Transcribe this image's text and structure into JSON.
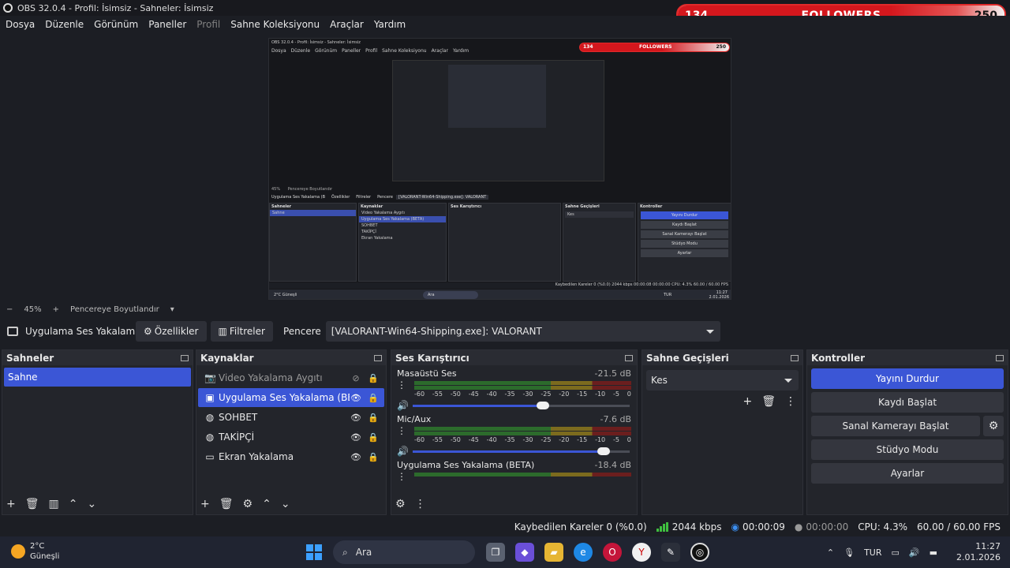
{
  "window": {
    "title": "OBS 32.0.4 - Profil: İsimsiz - Sahneler: İsimsiz"
  },
  "menu": [
    "Dosya",
    "Düzenle",
    "Görünüm",
    "Paneller",
    "Profil",
    "Sahne Koleksiyonu",
    "Araçlar",
    "Yardım"
  ],
  "followers_widget": {
    "current": "134",
    "label": "FOLLOWERS",
    "goal": "250",
    "progress": 0.536,
    "color": "#d4171d"
  },
  "preview": {
    "mini_title": "OBS 32.0.4 - Profil: İsimsiz - Sahneler: İsimsiz",
    "mini_menu": [
      "Dosya",
      "Düzenle",
      "Görünüm",
      "Paneller",
      "Profil",
      "Sahne Koleksiyonu",
      "Araçlar",
      "Yardım"
    ],
    "mini_followers": {
      "current": "134",
      "label": "FOLLOWERS",
      "goal": "250"
    },
    "mini_zoom": "45%",
    "mini_fit": "Pencereye Boyutlandır",
    "mini_source": "Uygulama Ses Yakalama (B",
    "mini_props": "Özellikler",
    "mini_filters": "Filtreler",
    "mini_window_label": "Pencere",
    "mini_window_value": "[VALORANT-Win64-Shipping.exe]: VALORANT",
    "mini_docks": {
      "scenes": "Sahneler",
      "scene": "Sahne",
      "sources": "Kaynaklar",
      "source_items": [
        "Video Yakalama Aygıtı",
        "Uygulama Ses Yakalama (BETA)",
        "SOHBET",
        "TAKİPÇİ",
        "Ekran Yakalama"
      ],
      "mixer": "Ses Karıştırıcı",
      "transitions": "Sahne Geçişleri",
      "transition": "Kes",
      "controls": "Kontroller",
      "control_buttons": [
        "Yayını Durdur",
        "Kaydı Başlat",
        "Sanal Kamerayı Başlat",
        "Stüdyo Modu",
        "Ayarlar"
      ]
    },
    "mini_status": "Kaybedilen Kareler 0 (%0.0)   2044 kbps   00:00:08   00:00:00   CPU: 4.3%   60.00 / 60.00 FPS",
    "mini_taskbar": {
      "weather": "2°C Güneşli",
      "search": "Ara",
      "lang": "TUR",
      "time": "11:27",
      "date": "2.01.2026"
    }
  },
  "zoom": {
    "minus": "−",
    "value": "45%",
    "plus": "+",
    "fit": "Pencereye Boyutlandır"
  },
  "source_bar": {
    "name": "Uygulama Ses Yakalama (B",
    "properties": "Özellikler",
    "filters": "Filtreler",
    "window_label": "Pencere",
    "window_value": "[VALORANT-Win64-Shipping.exe]: VALORANT"
  },
  "scenes": {
    "title": "Sahneler",
    "items": [
      "Sahne"
    ]
  },
  "sources": {
    "title": "Kaynaklar",
    "items": [
      {
        "name": "Video Yakalama Aygıtı",
        "icon": "camera-icon"
      },
      {
        "name": "Uygulama Ses Yakalama (BETA)",
        "icon": "app-audio-icon"
      },
      {
        "name": "SOHBET",
        "icon": "globe-icon"
      },
      {
        "name": "TAKİPÇİ",
        "icon": "globe-icon"
      },
      {
        "name": "Ekran Yakalama",
        "icon": "monitor-icon"
      }
    ]
  },
  "mixer": {
    "title": "Ses Karıştırıcı",
    "ticks": [
      "-60",
      "-55",
      "-50",
      "-45",
      "-40",
      "-35",
      "-30",
      "-25",
      "-20",
      "-15",
      "-10",
      "-5",
      "0"
    ],
    "tracks": [
      {
        "name": "Masaüstü Ses",
        "db": "-21.5 dB",
        "volume": 0.6
      },
      {
        "name": "Mic/Aux",
        "db": "-7.6 dB",
        "volume": 0.88
      },
      {
        "name": "Uygulama Ses Yakalama (BETA)",
        "db": "-18.4 dB"
      }
    ]
  },
  "transitions": {
    "title": "Sahne Geçişleri",
    "value": "Kes"
  },
  "controls": {
    "title": "Kontroller",
    "stop_stream": "Yayını Durdur",
    "start_record": "Kaydı Başlat",
    "start_vcam": "Sanal Kamerayı Başlat",
    "studio_mode": "Stüdyo Modu",
    "settings": "Ayarlar"
  },
  "status": {
    "dropped": "Kaybedilen Kareler 0 (%0.0)",
    "bitrate": "2044 kbps",
    "stream_time": "00:00:09",
    "record_time": "00:00:00",
    "cpu": "CPU: 4.3%",
    "fps": "60.00 / 60.00 FPS"
  },
  "taskbar": {
    "weather_temp": "2°C",
    "weather_desc": "Güneşli",
    "search": "Ara",
    "lang": "TUR",
    "time": "11:27",
    "date": "2.01.2026"
  }
}
